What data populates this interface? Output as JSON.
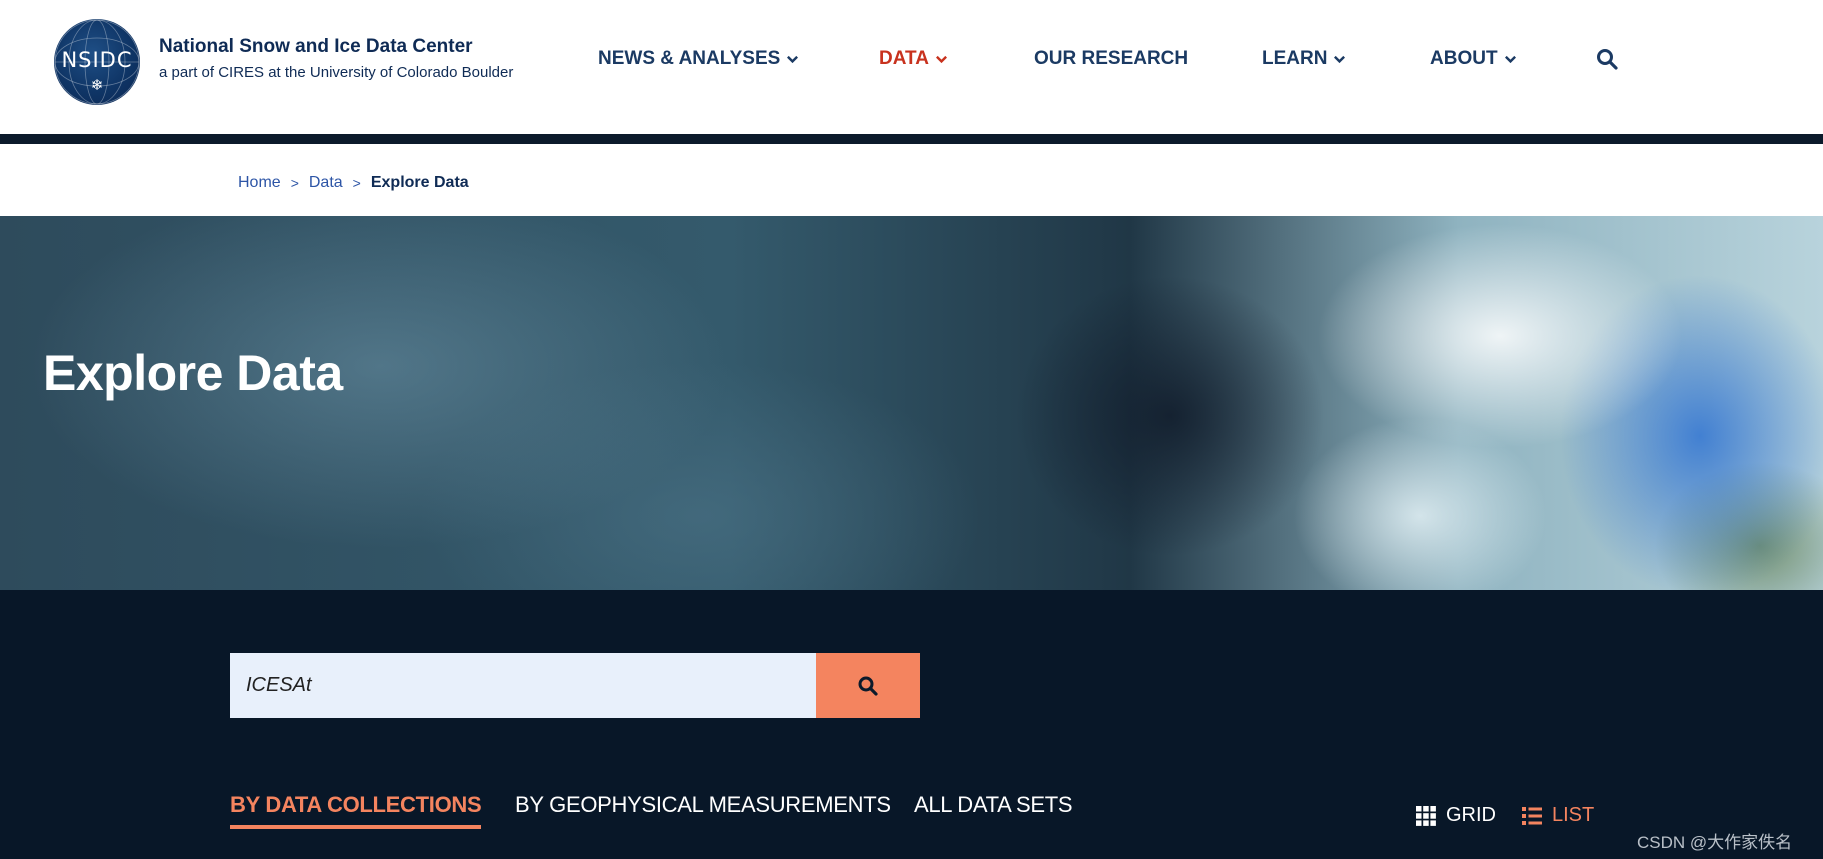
{
  "header": {
    "logo_text": "NSIDC",
    "org_name": "National Snow and Ice Data Center",
    "org_sub": "a part of CIRES at the University of Colorado Boulder"
  },
  "nav": {
    "items": [
      {
        "label": "NEWS & ANALYSES",
        "has_dropdown": true
      },
      {
        "label": "DATA",
        "has_dropdown": true,
        "active": true
      },
      {
        "label": "OUR RESEARCH",
        "has_dropdown": false
      },
      {
        "label": "LEARN",
        "has_dropdown": true
      },
      {
        "label": "ABOUT",
        "has_dropdown": true
      }
    ],
    "search_icon": "search-icon"
  },
  "breadcrumb": {
    "items": [
      "Home",
      "Data",
      "Explore Data"
    ],
    "separator": ">"
  },
  "hero": {
    "title": "Explore Data"
  },
  "search": {
    "value": "ICESAt",
    "placeholder": ""
  },
  "tabs": [
    {
      "label": "BY DATA COLLECTIONS",
      "active": true
    },
    {
      "label": "BY GEOPHYSICAL MEASUREMENTS",
      "active": false
    },
    {
      "label": "ALL DATA SETS",
      "active": false
    }
  ],
  "view": {
    "grid_label": "GRID",
    "list_label": "LIST",
    "selected": "LIST"
  },
  "watermark": "CSDN @大作家佚名",
  "colors": {
    "accent": "#f4845f",
    "nav_active": "#c8321e",
    "nav_text": "#1b3a63",
    "dark_bg": "#081728"
  }
}
